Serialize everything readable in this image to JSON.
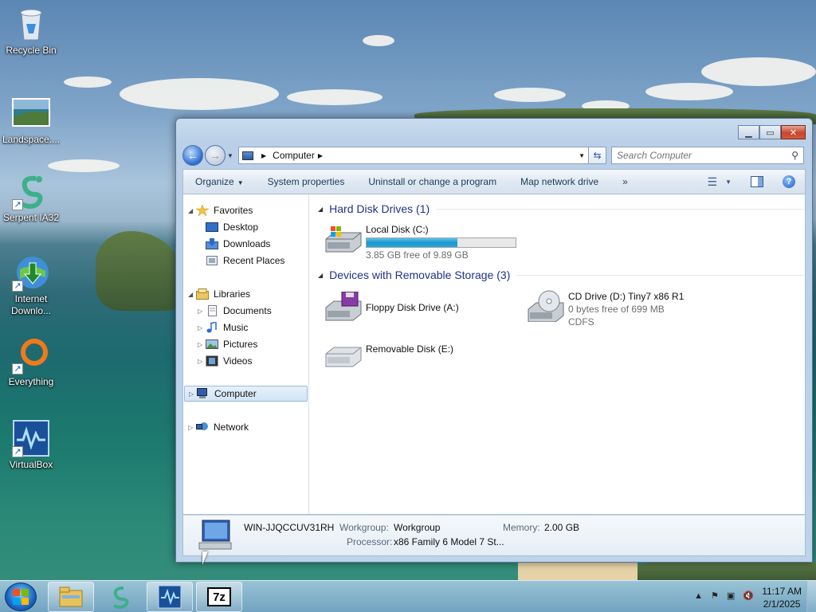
{
  "desktop": {
    "icons": [
      {
        "label": "Recycle Bin",
        "icon": "recycle-bin-icon"
      },
      {
        "label": "Landspace....",
        "icon": "landscape-image-icon"
      },
      {
        "label": "Serpent IA32",
        "icon": "serpent-icon"
      },
      {
        "label": "Internet Downlo...",
        "icon": "internet-download-manager-icon"
      },
      {
        "label": "Everything",
        "icon": "everything-search-icon"
      },
      {
        "label": "VirtualBox",
        "icon": "virtualbox-icon"
      }
    ]
  },
  "window": {
    "address": {
      "path": "Computer"
    },
    "search": {
      "placeholder": "Search Computer"
    },
    "toolbar": {
      "organize": "Organize",
      "system_properties": "System properties",
      "uninstall": "Uninstall or change a program",
      "map_drive": "Map network drive",
      "more": "»"
    },
    "nav": {
      "favorites": "Favorites",
      "desktop": "Desktop",
      "downloads": "Downloads",
      "recent": "Recent Places",
      "libraries": "Libraries",
      "documents": "Documents",
      "music": "Music",
      "pictures": "Pictures",
      "videos": "Videos",
      "computer": "Computer",
      "network": "Network"
    },
    "groups": {
      "hdd": "Hard Disk Drives (1)",
      "removable": "Devices with Removable Storage (3)"
    },
    "drives": {
      "c": {
        "name": "Local Disk (C:)",
        "free": "3.85 GB free of 9.89 GB",
        "used_fraction": 0.61
      },
      "a": {
        "name": "Floppy Disk Drive (A:)"
      },
      "d": {
        "name": "CD Drive (D:) Tiny7 x86 R1",
        "free": "0 bytes free of 699 MB",
        "fs": "CDFS"
      },
      "e": {
        "name": "Removable Disk (E:)"
      }
    },
    "details": {
      "computer_name": "WIN-JJQCCUV31RH",
      "workgroup_label": "Workgroup:",
      "workgroup": "Workgroup",
      "memory_label": "Memory:",
      "memory": "2.00 GB",
      "processor_label": "Processor:",
      "processor": "x86 Family 6 Model 7 St..."
    }
  },
  "taskbar": {
    "clock_time": "11:17 AM",
    "clock_date": "2/1/2025",
    "pinned": [
      "explorer-icon",
      "serpent-icon",
      "virtualbox-icon",
      "7zip-icon"
    ],
    "seven_zip_label": "7z"
  },
  "colors": {
    "accent": "#1e3287",
    "progress": "#1b97cd",
    "close": "#c8452c"
  }
}
